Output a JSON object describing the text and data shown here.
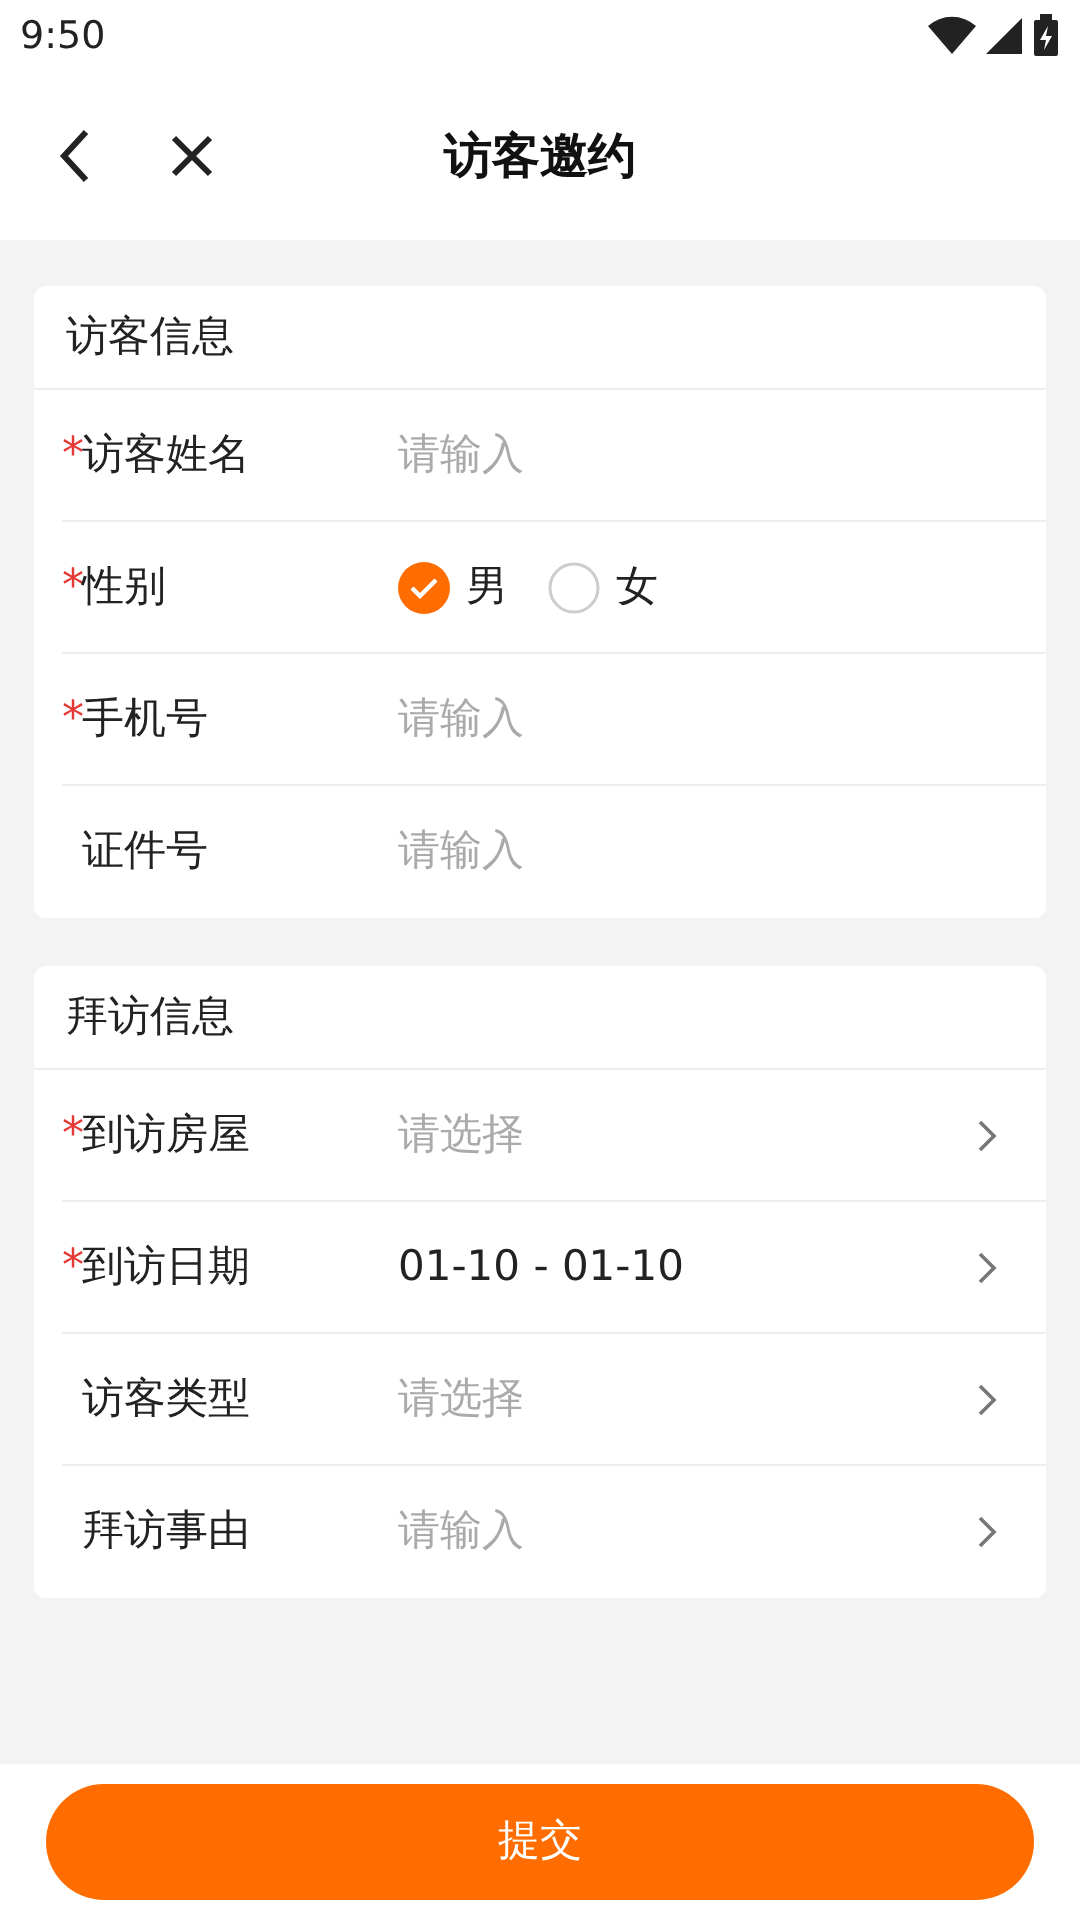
{
  "status_bar": {
    "time": "9:50"
  },
  "header": {
    "title": "访客邀约"
  },
  "sections": [
    {
      "title": "访客信息",
      "rows": [
        {
          "kind": "input",
          "label": "访客姓名",
          "required": true,
          "placeholder": "请输入"
        },
        {
          "kind": "radio",
          "label": "性别",
          "required": true,
          "options": [
            {
              "label": "男",
              "selected": true
            },
            {
              "label": "女",
              "selected": false
            }
          ]
        },
        {
          "kind": "input",
          "label": "手机号",
          "required": true,
          "placeholder": "请输入"
        },
        {
          "kind": "input",
          "label": "证件号",
          "required": false,
          "placeholder": "请输入"
        }
      ]
    },
    {
      "title": "拜访信息",
      "rows": [
        {
          "kind": "select",
          "label": "到访房屋",
          "required": true,
          "placeholder": "请选择"
        },
        {
          "kind": "select",
          "label": "到访日期",
          "required": true,
          "value": "01-10 - 01-10"
        },
        {
          "kind": "select",
          "label": "访客类型",
          "required": false,
          "placeholder": "请选择"
        },
        {
          "kind": "select",
          "label": "拜访事由",
          "required": false,
          "placeholder": "请输入"
        }
      ]
    }
  ],
  "required_mark": "*",
  "submit_button": "提交"
}
